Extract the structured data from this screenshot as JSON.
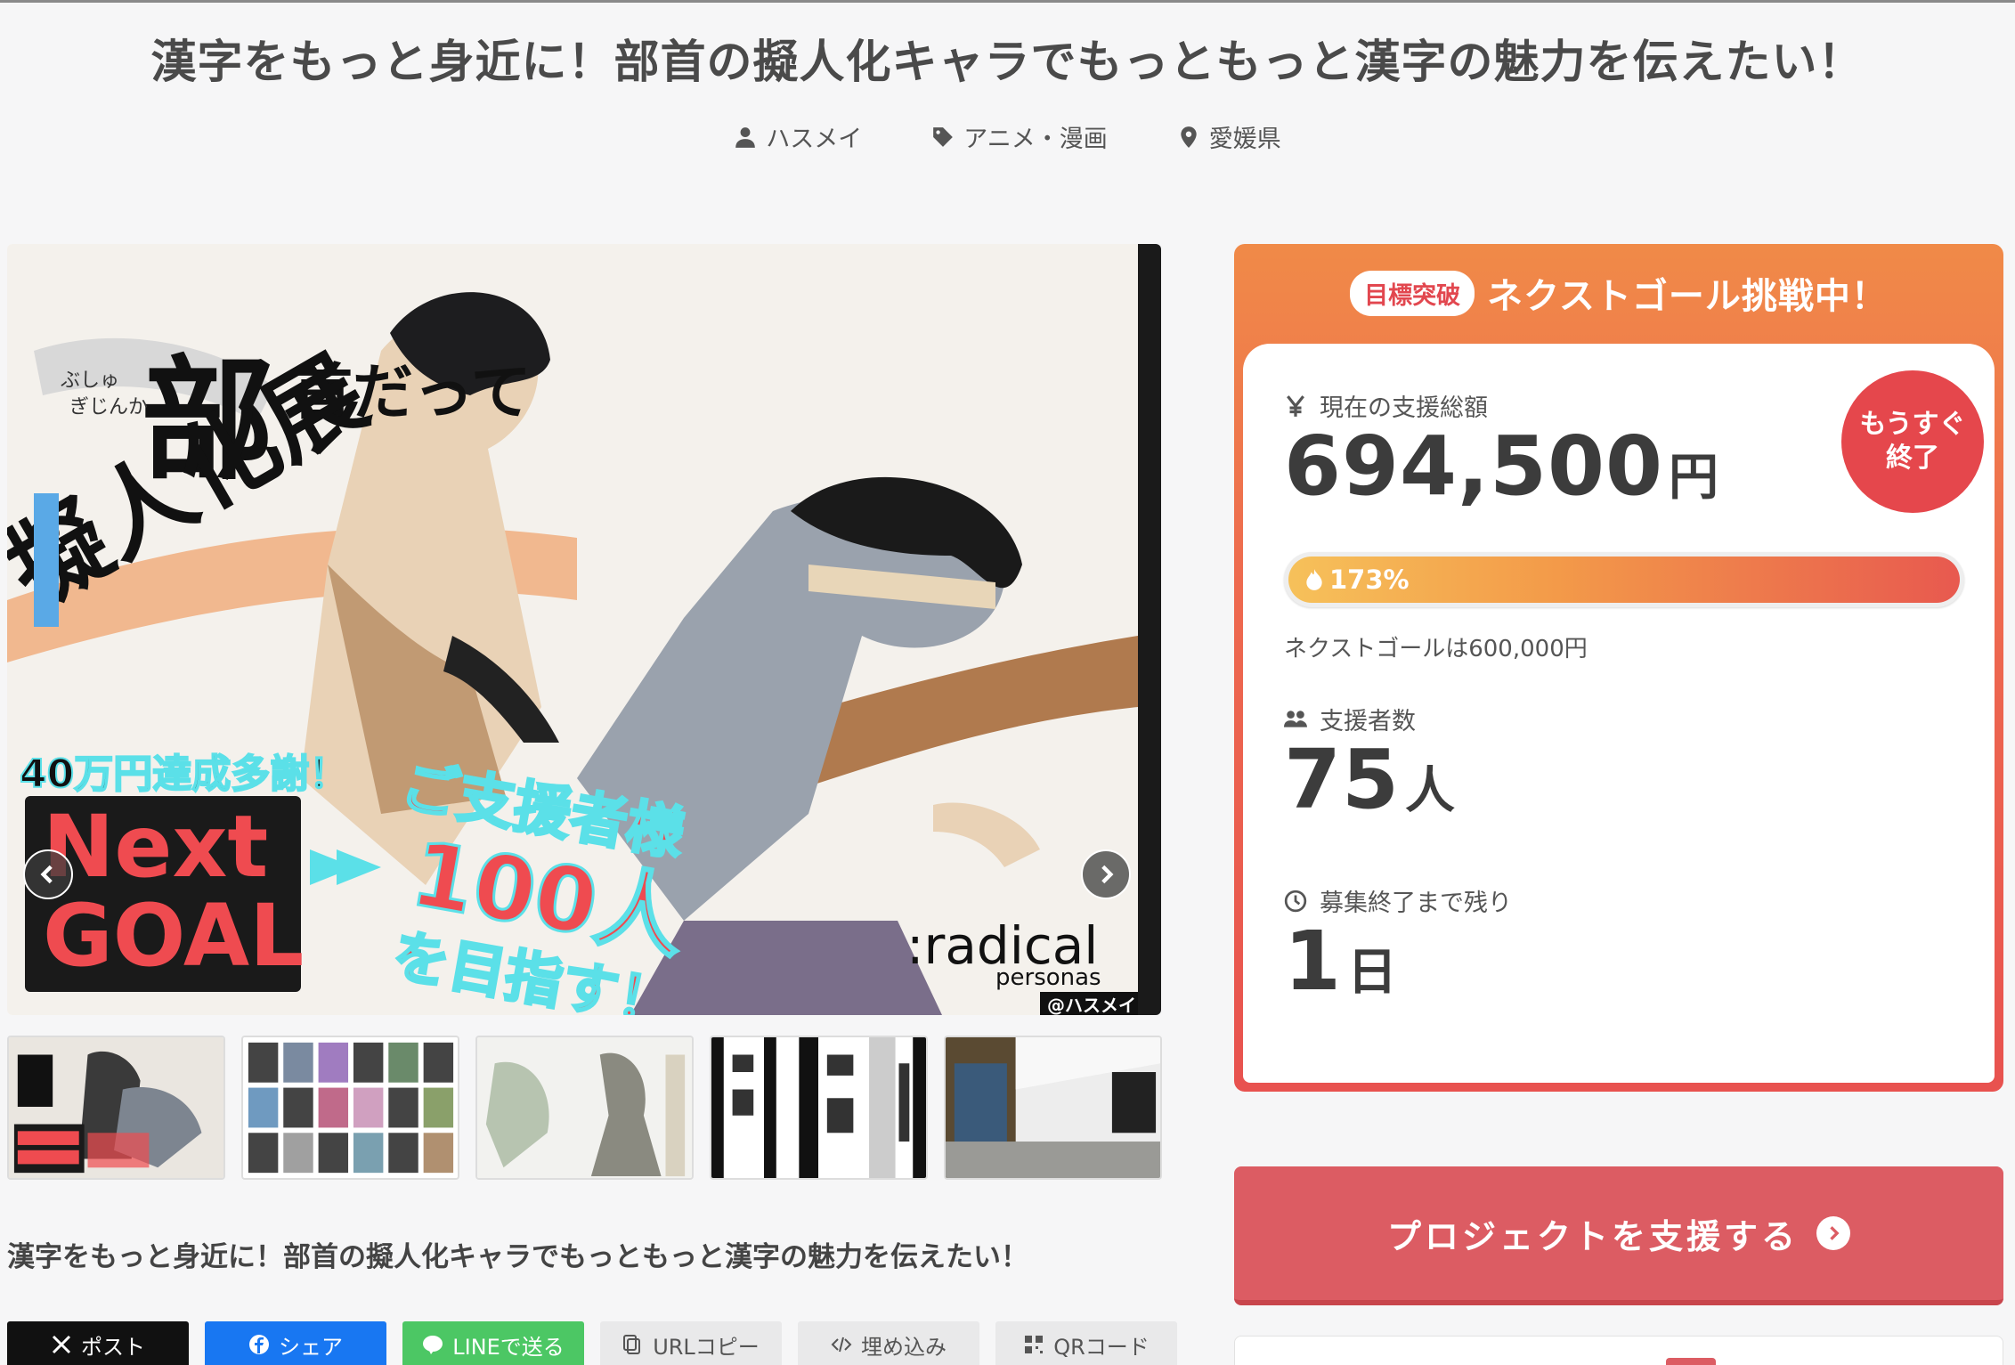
{
  "title": "漢字をもっと身近に！部首の擬人化キャラでもっともっと漢字の魅力を伝えたい！",
  "meta": {
    "author": "ハスメイ",
    "category": "アニメ・漫画",
    "location": "愛媛県"
  },
  "hero": {
    "art_text": {
      "bushu": "部",
      "datte": "首だって",
      "furigana_1": "ぶしゅ",
      "furigana_2": "ぎじんか",
      "gijinka": "擬人化展",
      "thanks": "40万円達成多謝！",
      "next": "Next",
      "goal": "GOAL",
      "target_1": "ご支援者様",
      "target_2": "100人",
      "target_3": "を目指す！",
      "brand": ":radical",
      "brand_sub": "personas",
      "credit": "@ハスメイ"
    },
    "prev_icon": "chevron-left-icon",
    "next_icon": "chevron-right-icon"
  },
  "subtitle": "漢字をもっと身近に！部首の擬人化キャラでもっともっと漢字の魅力を伝えたい！",
  "share": {
    "x": "ポスト",
    "facebook": "シェア",
    "line": "LINEで送る",
    "url": "URLコピー",
    "embed": "埋め込み",
    "qr": "QRコード"
  },
  "panel": {
    "goal_badge": "目標突破",
    "goal_text": "ネクストゴール挑戦中！",
    "amount_label": "現在の支援総額",
    "amount": "694,500",
    "amount_unit": "円",
    "soon_1": "もうすぐ",
    "soon_2": "終了",
    "progress_label": "173%",
    "progress": 1.73,
    "next_goal": "ネクストゴールは600,000円",
    "backers_label": "支援者数",
    "backers": "75",
    "backers_unit": "人",
    "remaining_label": "募集終了まで残り",
    "remaining": "1",
    "remaining_unit": "日"
  },
  "support_button": "プロジェクトを支援する",
  "colors": {
    "accent": "#dc5c63",
    "orange": "#f08a48",
    "red": "#e8524f"
  }
}
